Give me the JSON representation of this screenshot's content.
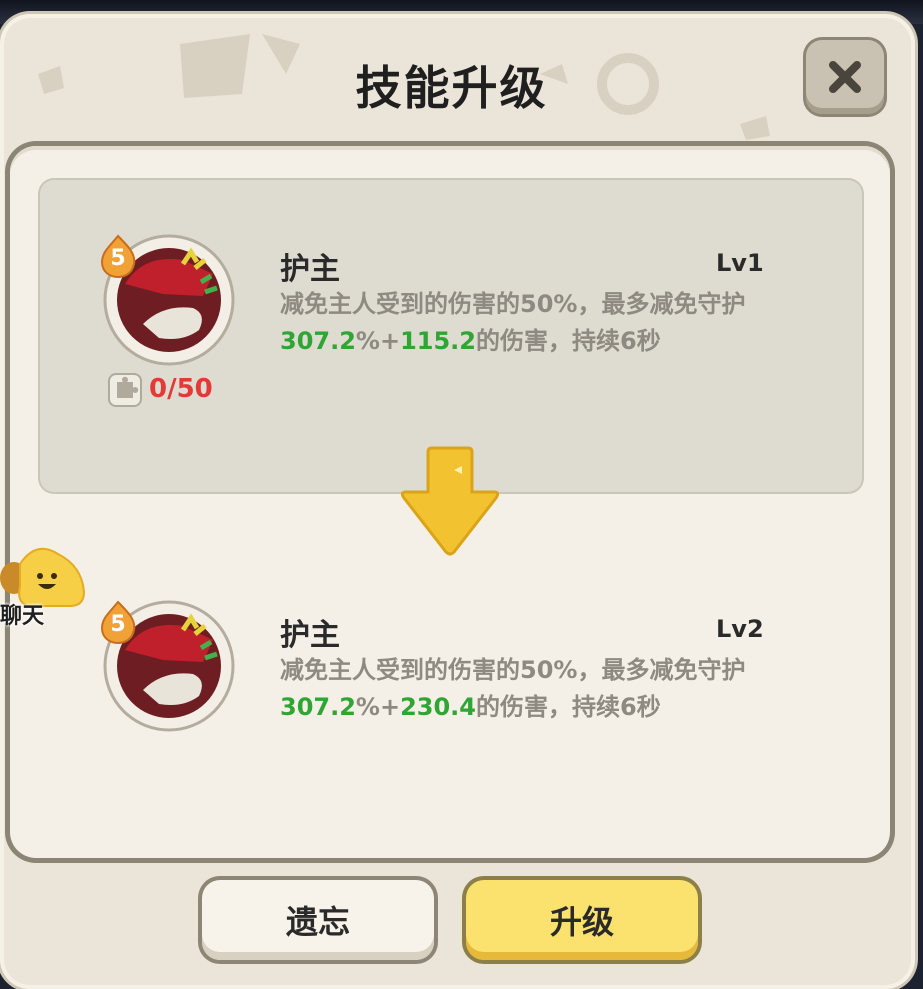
{
  "dialog": {
    "title": "技能升级"
  },
  "current": {
    "badge": "5",
    "name": "护主",
    "level": "Lv1",
    "desc_prefix": "减免主人受到的伤害的50%，最多减免守护",
    "percent": "307.2",
    "percent_unit": "%+",
    "flat": "115.2",
    "desc_suffix": "的伤害，持续6秒",
    "fragments": "0/50"
  },
  "next": {
    "badge": "5",
    "name": "护主",
    "level": "Lv2",
    "desc_prefix": "减免主人受到的伤害的50%，最多减免守护",
    "percent": "307.2",
    "percent_unit": "%+",
    "flat": "230.4",
    "desc_suffix": "的伤害，持续6秒"
  },
  "buttons": {
    "forget": "遗忘",
    "upgrade": "升级"
  },
  "chat": {
    "label": "聊天"
  },
  "colors": {
    "highlight_green": "#2fa533",
    "fragment_red": "#e23b37",
    "upgrade_yellow": "#fbe26e"
  },
  "icons": [
    "close-icon",
    "skill-guardian-icon",
    "puzzle-fragment-icon",
    "down-arrow-icon",
    "chat-emoji-icon"
  ]
}
